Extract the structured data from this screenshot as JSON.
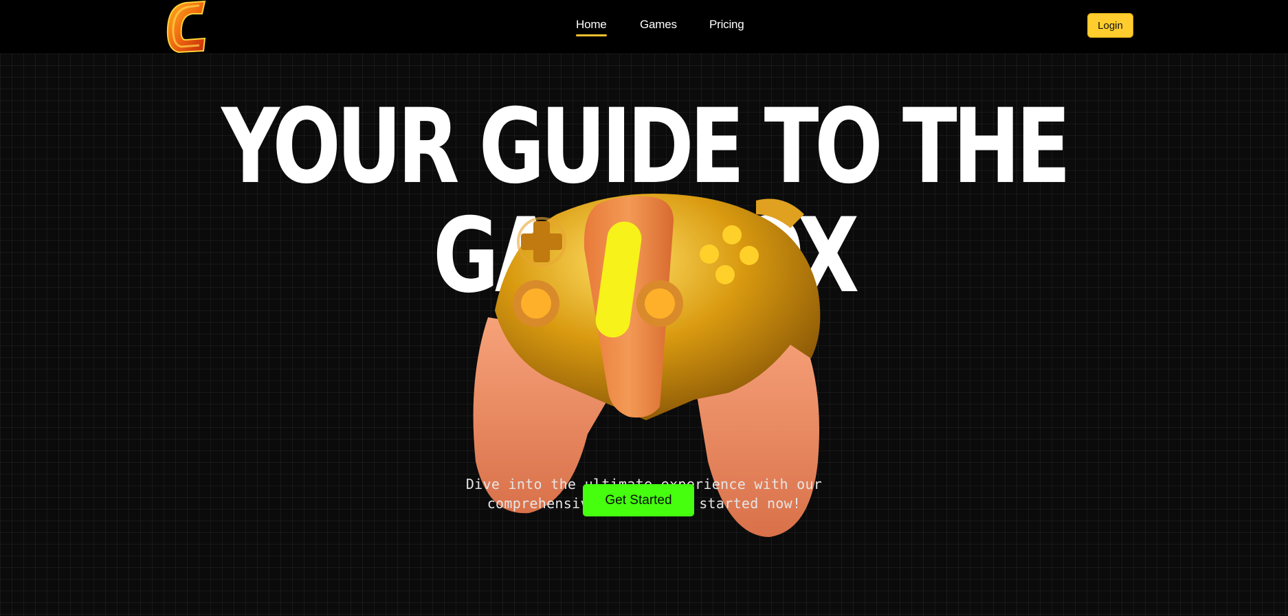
{
  "nav": {
    "items": [
      {
        "label": "Home",
        "active": true
      },
      {
        "label": "Games",
        "active": false
      },
      {
        "label": "Pricing",
        "active": false
      }
    ],
    "login_label": "Login"
  },
  "hero": {
    "headline_line1": "YOUR GUIDE TO THE",
    "headline_line2": "GAMEBOX",
    "tagline_line1": "Dive into the ultimate experience with our",
    "tagline_line2": "comprehensive guide. Get started now!",
    "cta_label": "Get Started"
  },
  "colors": {
    "background": "#000000",
    "accent_yellow": "#ffce2e",
    "cta_green": "#45ff0f",
    "logo_orange": "#e8550f"
  },
  "icons": {
    "logo": "brand-c-logo",
    "hero_image": "gamepad-controller"
  }
}
